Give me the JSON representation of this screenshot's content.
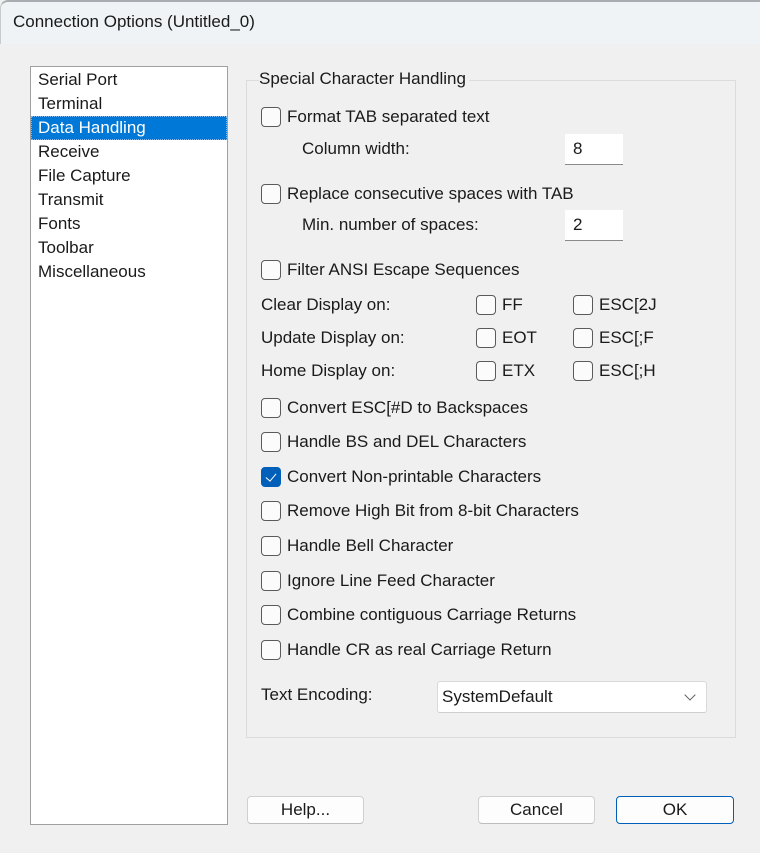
{
  "window": {
    "title": "Connection Options (Untitled_0)"
  },
  "sidebar": {
    "items": [
      {
        "label": "Serial Port",
        "selected": false
      },
      {
        "label": "Terminal",
        "selected": false
      },
      {
        "label": "Data Handling",
        "selected": true
      },
      {
        "label": "Receive",
        "selected": false
      },
      {
        "label": "File Capture",
        "selected": false
      },
      {
        "label": "Transmit",
        "selected": false
      },
      {
        "label": "Fonts",
        "selected": false
      },
      {
        "label": "Toolbar",
        "selected": false
      },
      {
        "label": "Miscellaneous",
        "selected": false
      }
    ]
  },
  "group": {
    "title": "Special Character Handling",
    "format_tab": {
      "label": "Format TAB separated text",
      "checked": false
    },
    "column_width": {
      "label": "Column width:",
      "value": "8"
    },
    "replace_spaces": {
      "label": "Replace consecutive spaces with TAB",
      "checked": false
    },
    "min_spaces": {
      "label": "Min. number of spaces:",
      "value": "2"
    },
    "filter_ansi": {
      "label": "Filter ANSI Escape Sequences",
      "checked": false
    },
    "display_rows": [
      {
        "label": "Clear Display on:",
        "opt1": {
          "label": "FF",
          "checked": false
        },
        "opt2": {
          "label": "ESC[2J",
          "checked": false
        }
      },
      {
        "label": "Update Display on:",
        "opt1": {
          "label": "EOT",
          "checked": false
        },
        "opt2": {
          "label": "ESC[;F",
          "checked": false
        }
      },
      {
        "label": "Home Display on:",
        "opt1": {
          "label": "ETX",
          "checked": false
        },
        "opt2": {
          "label": "ESC[;H",
          "checked": false
        }
      }
    ],
    "options": [
      {
        "label": "Convert ESC[#D to Backspaces",
        "checked": false
      },
      {
        "label": "Handle BS and DEL Characters",
        "checked": false
      },
      {
        "label": "Convert Non-printable Characters",
        "checked": true
      },
      {
        "label": "Remove High Bit from 8-bit Characters",
        "checked": false
      },
      {
        "label": "Handle Bell Character",
        "checked": false
      },
      {
        "label": "Ignore Line Feed Character",
        "checked": false
      },
      {
        "label": "Combine contiguous Carriage Returns",
        "checked": false
      },
      {
        "label": "Handle CR as real Carriage Return",
        "checked": false
      }
    ],
    "text_encoding": {
      "label": "Text Encoding:",
      "value": "SystemDefault"
    }
  },
  "buttons": {
    "help": "Help...",
    "cancel": "Cancel",
    "ok": "OK"
  },
  "colors": {
    "accent": "#0078d7",
    "checkbox_checked": "#005fb8"
  }
}
